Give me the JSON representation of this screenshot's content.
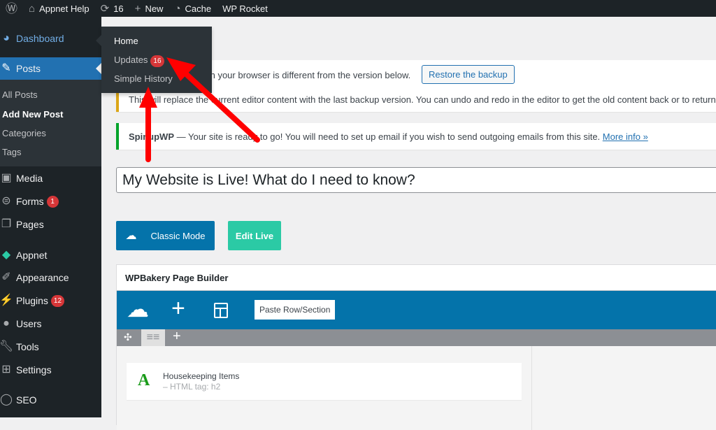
{
  "adminbar": {
    "site": "Appnet Help",
    "updates_count": "16",
    "new_label": "New",
    "cache_label": "Cache",
    "rocket_label": "WP Rocket",
    "icons": [
      "wordpress-icon",
      "home-icon",
      "updates-icon",
      "plus-icon",
      "cache-gauge-icon"
    ]
  },
  "sidebar": {
    "items": [
      {
        "label": "Dashboard",
        "icon": "dashboard-icon"
      },
      {
        "label": "Posts",
        "icon": "pin-icon"
      },
      {
        "label": "Media",
        "icon": "media-icon"
      },
      {
        "label": "Forms",
        "icon": "forms-icon",
        "badge": "1"
      },
      {
        "label": "Pages",
        "icon": "pages-icon"
      },
      {
        "label": "Appnet",
        "icon": "diamond-icon"
      },
      {
        "label": "Appearance",
        "icon": "brush-icon"
      },
      {
        "label": "Plugins",
        "icon": "plugin-icon",
        "badge": "12"
      },
      {
        "label": "Users",
        "icon": "users-icon"
      },
      {
        "label": "Tools",
        "icon": "wrench-icon"
      },
      {
        "label": "Settings",
        "icon": "settings-icon"
      },
      {
        "label": "SEO",
        "icon": "seo-icon"
      }
    ],
    "posts_sub": [
      "All Posts",
      "Add New Post",
      "Categories",
      "Tags"
    ]
  },
  "flyout": {
    "home": "Home",
    "updates": "Updates",
    "updates_badge": "16",
    "history": "Simple History"
  },
  "notices": {
    "backup_text": "st in your browser is different from the version below.",
    "restore_button": "Restore the backup",
    "backup_note": "This will replace the current editor content with the last backup version. You can undo and redo in the editor to get the old content back or to return",
    "spinup_strong": "SpinupWP",
    "spinup_text": " — Your site is ready to go! You will need to set up email if you wish to send outgoing emails from this site. ",
    "more_info": "More info »"
  },
  "post": {
    "title": "My Website is Live! What do I need to know?"
  },
  "buttons": {
    "classic": "Classic Mode",
    "edit_live": "Edit Live"
  },
  "wpbakery": {
    "title": "WPBakery Page Builder",
    "paste": "Paste Row/Section",
    "element_title": "Housekeeping Items",
    "element_sub": "– HTML tag: h2"
  },
  "colors": {
    "admin_dark": "#1d2327",
    "accent_blue": "#2271b1",
    "builder_blue": "#0473aa",
    "edit_live": "#2bcaa5",
    "badge_red": "#d63638",
    "arrow_red": "#ff0000"
  }
}
